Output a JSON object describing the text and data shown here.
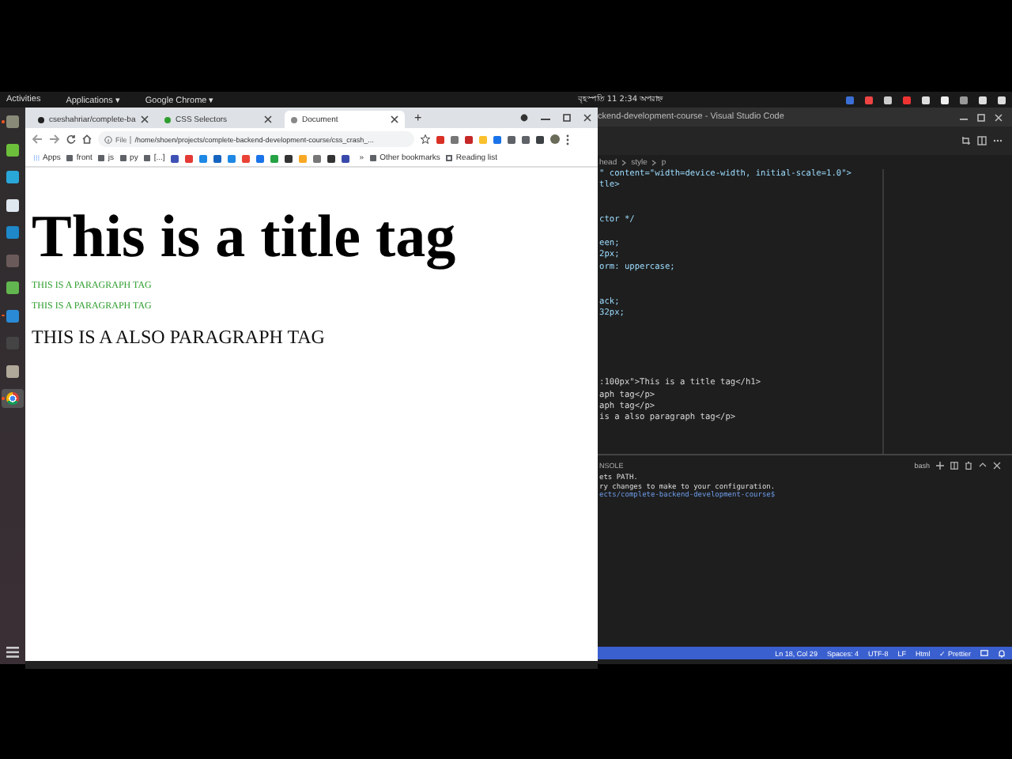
{
  "top_bar": {
    "activities": "Activities",
    "menus": [
      "Applications ▾",
      "Google Chrome ▾"
    ],
    "clock": "বৃহস্পতি 11  2:34 অপরাহ্ন"
  },
  "dock": [
    {
      "running": true,
      "selected": false
    },
    {
      "running": false,
      "selected": false
    },
    {
      "running": false,
      "selected": false
    },
    {
      "running": false,
      "selected": false
    },
    {
      "running": false,
      "selected": false
    },
    {
      "running": false,
      "selected": false
    },
    {
      "running": false,
      "selected": false
    },
    {
      "running": true,
      "selected": false
    },
    {
      "running": false,
      "selected": false
    },
    {
      "running": false,
      "selected": false
    },
    {
      "running": true,
      "selected": true
    }
  ],
  "browser": {
    "tabs": [
      {
        "title": "cseshahriar/complete-ba",
        "selected": false
      },
      {
        "title": "CSS Selectors",
        "selected": false
      },
      {
        "title": "Document",
        "selected": true
      }
    ],
    "new_tab": "+",
    "address": {
      "scheme": "File",
      "url": "/home/shoen/projects/complete-backend-development-course/css_crash_..."
    },
    "bookmarks": [
      "Apps",
      "front",
      "js",
      "py",
      "[...]"
    ],
    "overflow": "»",
    "other_bookmarks": "Other bookmarks",
    "reading_list": "Reading list"
  },
  "page": {
    "heading": "This is a title tag",
    "paragraphs": [
      {
        "text": "THIS IS A PARAGRAPH TAG",
        "color": "#2e9e2e",
        "kind": "small"
      },
      {
        "text": "THIS IS A PARAGRAPH TAG",
        "color": "#2e9e2e",
        "kind": "small"
      },
      {
        "text": "THIS IS A ALSO PARAGRAPH TAG",
        "color": "#111111",
        "kind": "large"
      }
    ]
  },
  "editor": {
    "title": "ckend-development-course - Visual Studio Code",
    "breadcrumbs": [
      "head",
      "style",
      "p"
    ],
    "code_lines": [
      "\" content=\"width=device-width, initial-scale=1.0\">",
      "tle>",
      "ctor */",
      "een;",
      "2px;",
      "orm: uppercase;",
      "ack;",
      "32px;",
      ":100px\">This is a title tag</h1>",
      "aph tag</p>",
      "aph tag</p>",
      "is a also paragraph tag</p>"
    ],
    "panel_title": "NSOLE",
    "terminal_lines": [
      "ets PATH.",
      "ry changes to make to your configuration.",
      "ects/complete-backend-development-course$"
    ],
    "shell": "bash",
    "status_items": [
      "Ln 18, Col 29",
      "Spaces: 4",
      "UTF-8",
      "LF",
      "Html",
      "✓ Prettier"
    ]
  }
}
